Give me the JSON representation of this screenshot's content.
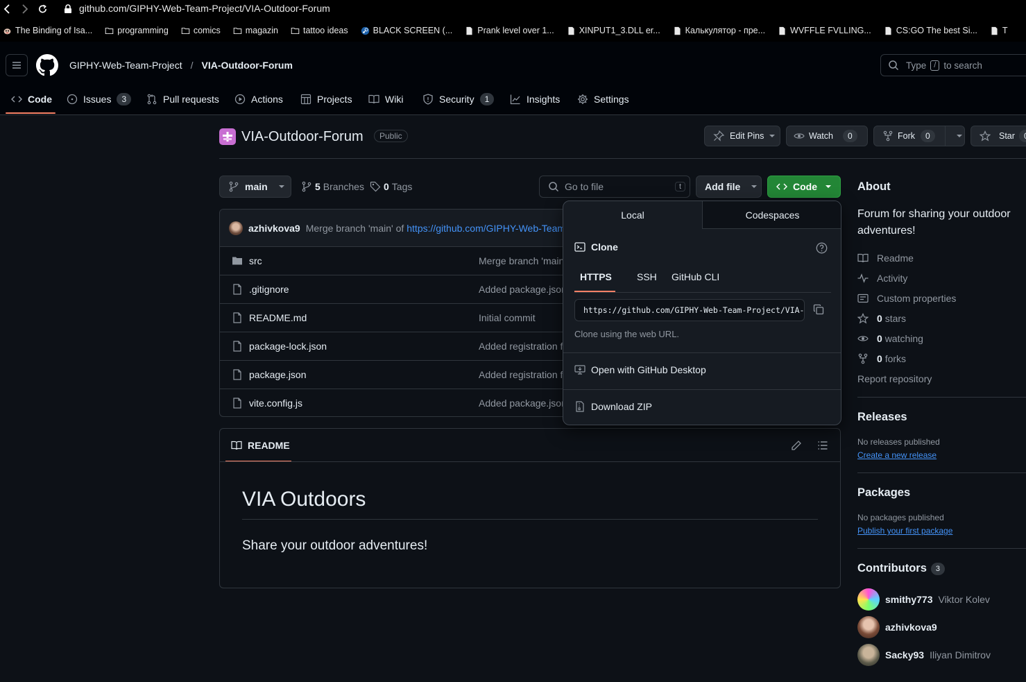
{
  "browser": {
    "url": "github.com/GIPHY-Web-Team-Project/VIA-Outdoor-Forum",
    "bookmarks": [
      {
        "label": "The Binding of Isa...",
        "icon": "bookmark-page-icon"
      },
      {
        "label": "programming",
        "icon": "folder-icon"
      },
      {
        "label": "comics",
        "icon": "folder-icon"
      },
      {
        "label": "magazin",
        "icon": "folder-icon"
      },
      {
        "label": "tattoo ideas",
        "icon": "folder-icon"
      },
      {
        "label": "BLACK SCREEN (...",
        "icon": "steam-icon"
      },
      {
        "label": "Prank level over 1...",
        "icon": "page-icon"
      },
      {
        "label": "XINPUT1_3.DLL er...",
        "icon": "page-icon"
      },
      {
        "label": "Калькулятор - пре...",
        "icon": "page-icon"
      },
      {
        "label": "WVFFLE FVLLING...",
        "icon": "page-icon"
      },
      {
        "label": "CS:GO The best Si...",
        "icon": "page-icon"
      },
      {
        "label": "T",
        "icon": "page-icon"
      }
    ]
  },
  "header": {
    "owner": "GIPHY-Web-Team-Project",
    "separator": "/",
    "repo": "VIA-Outdoor-Forum",
    "search_prefix": "Type",
    "search_key": "/",
    "search_suffix": "to search"
  },
  "tabs": [
    {
      "label": "Code",
      "icon": "code-icon"
    },
    {
      "label": "Issues",
      "icon": "issue-icon",
      "count": "3"
    },
    {
      "label": "Pull requests",
      "icon": "pull-request-icon"
    },
    {
      "label": "Actions",
      "icon": "play-icon"
    },
    {
      "label": "Projects",
      "icon": "table-icon"
    },
    {
      "label": "Wiki",
      "icon": "book-icon"
    },
    {
      "label": "Security",
      "icon": "shield-icon",
      "count": "1"
    },
    {
      "label": "Insights",
      "icon": "graph-icon"
    },
    {
      "label": "Settings",
      "icon": "gear-icon"
    }
  ],
  "repo": {
    "title": "VIA-Outdoor-Forum",
    "visibility": "Public",
    "edit_pins": "Edit Pins",
    "watch": "Watch",
    "watch_count": "0",
    "fork": "Fork",
    "fork_count": "0",
    "star": "Star",
    "star_count": "0"
  },
  "toolbar": {
    "branch": "main",
    "branches_count": "5",
    "branches_label": "Branches",
    "tags_count": "0",
    "tags_label": "Tags",
    "go_to_file": "Go to file",
    "go_to_file_key": "t",
    "add_file": "Add file",
    "code": "Code"
  },
  "commit": {
    "author": "azhivkova9",
    "message": "Merge branch 'main' of",
    "link": "https://github.com/GIPHY-Web-Team"
  },
  "files": [
    {
      "name": "src",
      "type": "folder",
      "message": "Merge branch 'main"
    },
    {
      "name": ".gitignore",
      "type": "file",
      "message": "Added package.json"
    },
    {
      "name": "README.md",
      "type": "file",
      "message": "Initial commit"
    },
    {
      "name": "package-lock.json",
      "type": "file",
      "message": "Added registration f"
    },
    {
      "name": "package.json",
      "type": "file",
      "message": "Added registration f"
    },
    {
      "name": "vite.config.js",
      "type": "file",
      "message": "Added package.json"
    }
  ],
  "readme": {
    "tab": "README",
    "heading": "VIA Outdoors",
    "text": "Share your outdoor adventures!"
  },
  "code_dropdown": {
    "tab_local": "Local",
    "tab_codespaces": "Codespaces",
    "clone_title": "Clone",
    "sub_tabs": [
      "HTTPS",
      "SSH",
      "GitHub CLI"
    ],
    "clone_url": "https://github.com/GIPHY-Web-Team-Project/VIA-Outdoor-Forum.git",
    "clone_hint": "Clone using the web URL.",
    "open_desktop": "Open with GitHub Desktop",
    "download_zip": "Download ZIP"
  },
  "about": {
    "heading": "About",
    "description": "Forum for sharing your outdoor adventures!",
    "readme": "Readme",
    "activity": "Activity",
    "custom_properties": "Custom properties",
    "stars_count": "0",
    "stars_label": "stars",
    "watching_count": "0",
    "watching_label": "watching",
    "forks_count": "0",
    "forks_label": "forks",
    "report": "Report repository"
  },
  "releases": {
    "heading": "Releases",
    "empty": "No releases published",
    "create_link": "Create a new release"
  },
  "packages": {
    "heading": "Packages",
    "empty": "No packages published",
    "publish_link": "Publish your first package"
  },
  "contributors": {
    "heading": "Contributors",
    "count": "3",
    "list": [
      {
        "login": "smithy773",
        "name": "Viktor Kolev"
      },
      {
        "login": "azhivkova9",
        "name": ""
      },
      {
        "login": "Sacky93",
        "name": "Iliyan Dimitrov"
      }
    ]
  },
  "colors": {
    "accent_orange": "#f78166",
    "green_button": "#238636",
    "link_blue": "#4493f8",
    "bg": "#0d1117"
  }
}
